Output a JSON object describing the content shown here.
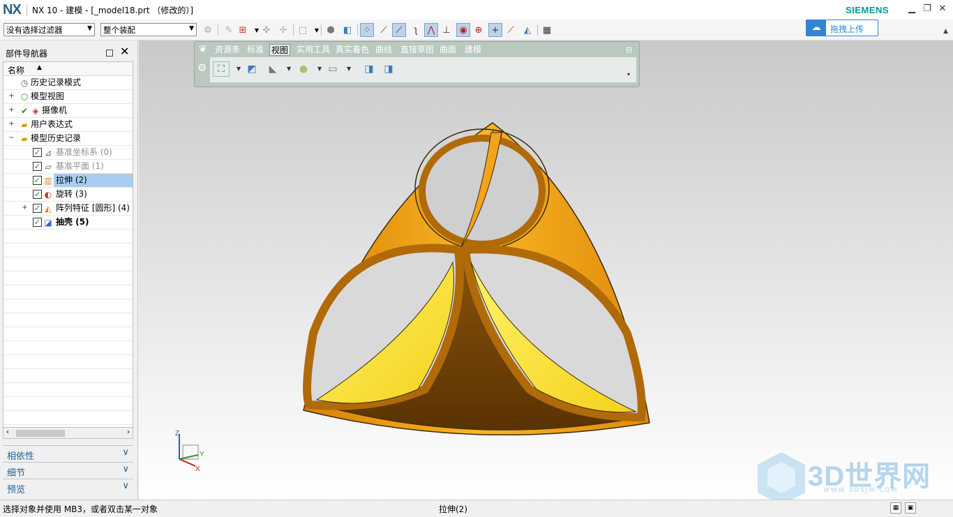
{
  "window": {
    "logo": "NX",
    "title": "NX 10 - 建模 - [_model18.prt （修改的）]",
    "brand": "SIEMENS",
    "min": "▁",
    "restore": "❐",
    "close": "✕"
  },
  "toolbar": {
    "selection_filter": "没有选择过滤器",
    "scope": "整个装配",
    "upload_label": "拖拽上传"
  },
  "ribbon": {
    "tabs": [
      "资源条",
      "标准",
      "视图",
      "实用工具",
      "真实着色",
      "曲线",
      "直接草图",
      "曲面",
      "建模"
    ],
    "active_tab": "视图"
  },
  "navigator": {
    "title": "部件导航器",
    "column_name": "名称",
    "items": [
      {
        "label": "历史记录模式",
        "icon": "clock-icon"
      },
      {
        "label": "模型视图",
        "icon": "model-views-icon"
      },
      {
        "label": "摄像机",
        "icon": "camera-icon"
      },
      {
        "label": "用户表达式",
        "icon": "folder-icon"
      },
      {
        "label": "模型历史记录",
        "icon": "folder-open-icon"
      },
      {
        "label": "基准坐标系 (0)",
        "icon": "datum-csys-icon"
      },
      {
        "label": "基准平面 (1)",
        "icon": "datum-plane-icon"
      },
      {
        "label": "拉伸 (2)",
        "icon": "extrude-icon"
      },
      {
        "label": "旋转 (3)",
        "icon": "revolve-icon"
      },
      {
        "label": "阵列特征 [圆形] (4)",
        "icon": "pattern-feature-icon"
      },
      {
        "label": "抽壳 (5)",
        "icon": "shell-icon"
      }
    ],
    "sections": [
      "相依性",
      "细节",
      "预览"
    ]
  },
  "model": {
    "body_color": "#f0a414",
    "face_color": "#fef048",
    "shadow_color": "#6a3d06"
  },
  "triad": {
    "z": "Z",
    "y": "Y",
    "x": "X"
  },
  "status": {
    "prompt": "选择对象并使用 MB3，或者双击某一对象",
    "selection": "拉伸(2)"
  },
  "watermark": {
    "text": "3D世界网",
    "sub": "WWW.3DSJW.COM"
  }
}
